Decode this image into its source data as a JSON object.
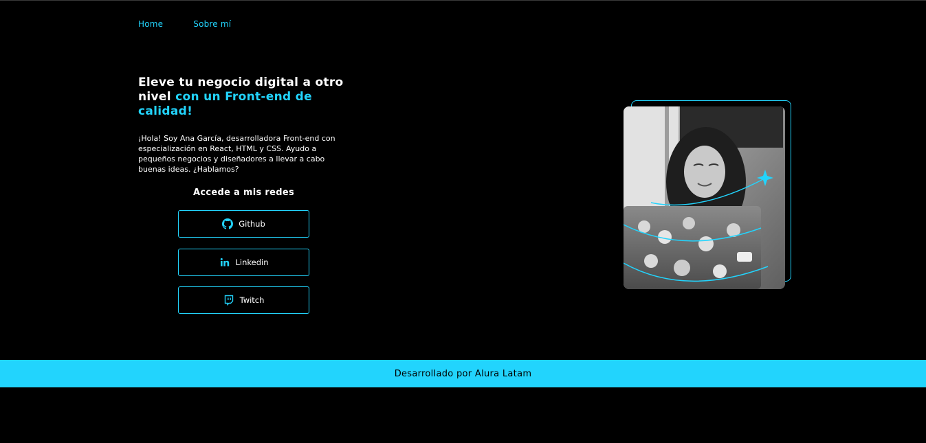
{
  "nav": {
    "home": "Home",
    "about": "Sobre mí"
  },
  "hero": {
    "title_part1": "Eleve tu negocio digital a otro nivel ",
    "title_accent": "con un Front-end de calidad!",
    "description": "¡Hola! Soy Ana García, desarrolladora Front-end con especialización en React, HTML y CSS. Ayudo a pequeños negocios y diseñadores a llevar a cabo buenas ideas. ¿Hablamos?"
  },
  "social": {
    "heading": "Accede a mis redes",
    "buttons": [
      {
        "label": "Github",
        "icon": "github-icon"
      },
      {
        "label": "Linkedin",
        "icon": "linkedin-icon"
      },
      {
        "label": "Twitch",
        "icon": "twitch-icon"
      }
    ]
  },
  "footer": {
    "text": "Desarrollado por Alura Latam"
  },
  "colors": {
    "accent": "#22d4fd",
    "background": "#000000",
    "text": "#ffffff"
  }
}
